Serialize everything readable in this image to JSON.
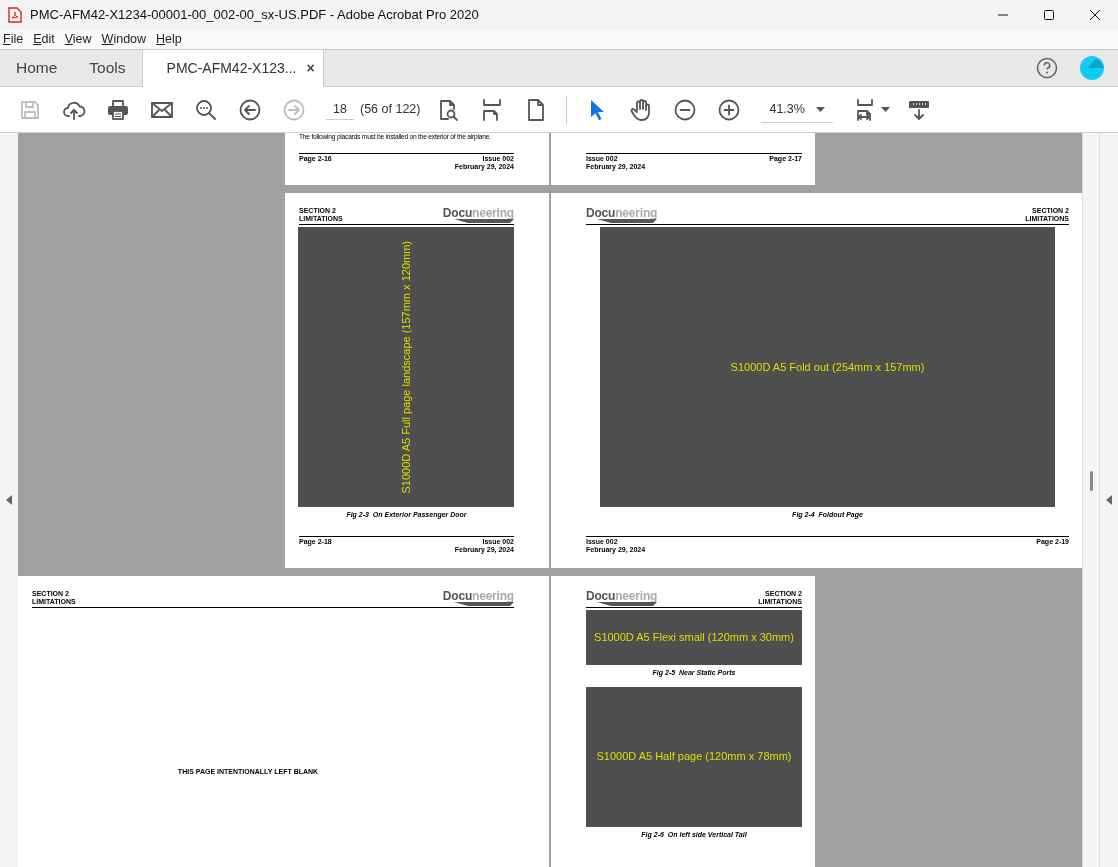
{
  "window": {
    "title": "PMC-AFM42-X1234-00001-00_002-00_sx-US.PDF - Adobe Acrobat Pro 2020"
  },
  "menu": [
    "File",
    "Edit",
    "View",
    "Window",
    "Help"
  ],
  "tabs": [
    {
      "label": "Home",
      "selected": false,
      "kind": "nav"
    },
    {
      "label": "Tools",
      "selected": false,
      "kind": "nav"
    },
    {
      "label": "PMC-AFM42-X123...",
      "selected": true,
      "kind": "document",
      "close": "×"
    }
  ],
  "toolbar": {
    "page_number": "18",
    "page_count": "(56 of 122)",
    "zoom": "41.3%",
    "buttons": [
      {
        "kind": "save",
        "disabled": true
      },
      {
        "kind": "share",
        "disabled": false
      },
      {
        "kind": "print",
        "disabled": false
      },
      {
        "kind": "email",
        "disabled": false
      },
      {
        "kind": "search",
        "disabled": false
      },
      {
        "kind": "previous_page",
        "disabled": false
      },
      {
        "kind": "next_page",
        "disabled": true
      },
      {
        "kind": "page_field"
      },
      {
        "kind": "find",
        "disabled": false
      },
      {
        "kind": "fit_page",
        "disabled": false
      },
      {
        "kind": "single_page",
        "disabled": false
      },
      {
        "kind": "separator"
      },
      {
        "kind": "select",
        "disabled": false,
        "selected": true
      },
      {
        "kind": "hand",
        "disabled": false,
        "selected": false
      },
      {
        "kind": "zoom_out",
        "disabled": false
      },
      {
        "kind": "zoom_in",
        "disabled": false
      },
      {
        "kind": "zoom_field"
      },
      {
        "kind": "fit_width",
        "disabled": false
      },
      {
        "kind": "read",
        "disabled": false
      }
    ]
  },
  "rows": [
    {
      "pages": [
        {
          "body": [
            {
              "kind": "paragraph",
              "text": "The following placards must be installed on the exterior of the airplane."
            }
          ],
          "footer": {
            "page": "Page 2-16",
            "issue": "Issue 002",
            "date": "February 29, 2024"
          }
        },
        {
          "footer": {
            "page": "Page 2-17",
            "issue": "Issue 002",
            "date": "February 29, 2024"
          }
        }
      ]
    },
    {
      "pages": [
        {
          "header": {
            "section": "SECTION 2",
            "title": "LIMITATIONS",
            "logo_dark": "Docu",
            "logo_light": "neering"
          },
          "body": [
            {
              "kind": "portrait",
              "label": "S1000D A5 Full page landscape (157mm x 120mm)",
              "caption": "Fig 2-3  On Exterior Passenger Door"
            }
          ],
          "footer": {
            "page": "Page 2-18",
            "issue": "Issue 002",
            "date": "February 29, 2024"
          }
        },
        {
          "header": {
            "section": "SECTION 2",
            "title": "LIMITATIONS",
            "logo_dark": "Docu",
            "logo_light": "neering"
          },
          "body": [
            {
              "kind": "foldout",
              "label": "S1000D A5 Fold out (254mm x 157mm)",
              "caption": "Fig 2-4  Foldout Page"
            }
          ],
          "footer": {
            "page": "Page 2-19",
            "issue": "Issue 002",
            "date": "February 29, 2024"
          }
        }
      ]
    },
    {
      "pages": [
        {
          "header": {
            "section": "SECTION 2",
            "title": "LIMITATIONS",
            "logo_dark": "Docu",
            "logo_light": "neering"
          },
          "body": [
            {
              "kind": "notice",
              "text": "THIS PAGE INTENTIONALLY LEFT BLANK"
            }
          ]
        },
        {
          "header": {
            "section": "SECTION 2",
            "title": "LIMITATIONS",
            "logo_dark": "Docu",
            "logo_light": "neering"
          },
          "body": [
            {
              "kind": "flexi",
              "label": "S1000D A5 Flexi small (120mm x 30mm)",
              "caption": "Fig 2-5  Near Static Ports"
            },
            {
              "kind": "halfpage",
              "label": "S1000D A5 Half page (120mm x 78mm)",
              "caption": "Fig 2-6  On left side Vertical Tail"
            }
          ]
        }
      ]
    }
  ]
}
